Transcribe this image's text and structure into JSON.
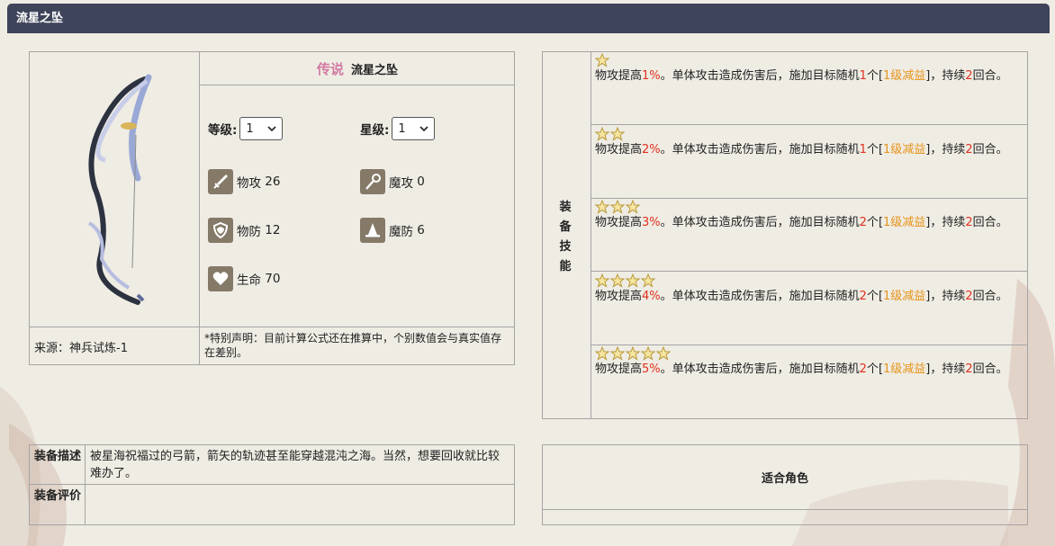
{
  "header": {
    "title": "流星之坠"
  },
  "item": {
    "rarity": "传说",
    "name": "流星之坠",
    "level_label": "等级:",
    "level_value": "1",
    "star_label": "星级:",
    "star_value": "1",
    "source": "来源：神兵试炼-1",
    "disclaimer": "*特别声明：目前计算公式还在推算中，个别数值会与真实值存在差别。"
  },
  "stats": [
    {
      "icon": "sword-icon",
      "label": "物攻",
      "value": "26"
    },
    {
      "icon": "magic-wand-icon",
      "label": "魔攻",
      "value": "0"
    },
    {
      "icon": "shield-icon",
      "label": "物防",
      "value": "12"
    },
    {
      "icon": "wizard-hat-icon",
      "label": "魔防",
      "value": "6"
    },
    {
      "icon": "heart-icon",
      "label": "生命",
      "value": "70"
    }
  ],
  "skills": {
    "header": "装备技能",
    "tiers": [
      {
        "stars": 1,
        "a": "物攻提高",
        "pct": "1%",
        "b": "。单体攻击造成伤害后，施加目标随机",
        "n": "1",
        "c": "个[",
        "debuff": "1级减益",
        "d": "]，持续",
        "dur": "2",
        "e": "回合。"
      },
      {
        "stars": 2,
        "a": "物攻提高",
        "pct": "2%",
        "b": "。单体攻击造成伤害后，施加目标随机",
        "n": "1",
        "c": "个[",
        "debuff": "1级减益",
        "d": "]，持续",
        "dur": "2",
        "e": "回合。"
      },
      {
        "stars": 3,
        "a": "物攻提高",
        "pct": "3%",
        "b": "。单体攻击造成伤害后，施加目标随机",
        "n": "2",
        "c": "个[",
        "debuff": "1级减益",
        "d": "]，持续",
        "dur": "2",
        "e": "回合。"
      },
      {
        "stars": 4,
        "a": "物攻提高",
        "pct": "4%",
        "b": "。单体攻击造成伤害后，施加目标随机",
        "n": "2",
        "c": "个[",
        "debuff": "1级减益",
        "d": "]，持续",
        "dur": "2",
        "e": "回合。"
      },
      {
        "stars": 5,
        "a": "物攻提高",
        "pct": "5%",
        "b": "。单体攻击造成伤害后，施加目标随机",
        "n": "2",
        "c": "个[",
        "debuff": "1级减益",
        "d": "]，持续",
        "dur": "2",
        "e": "回合。"
      }
    ]
  },
  "description": {
    "label": "装备描述",
    "text": "被星海祝福过的弓箭，箭矢的轨迹甚至能穿越混沌之海。当然，想要回收就比较难办了。",
    "eval_label": "装备评价",
    "eval_text": ""
  },
  "roles": {
    "label": "适合角色"
  },
  "colors": {
    "header_bg": "#3e4459",
    "highlight_red": "#e0301e",
    "highlight_orange": "#e6941a",
    "legend_pink": "#d27ba3"
  }
}
